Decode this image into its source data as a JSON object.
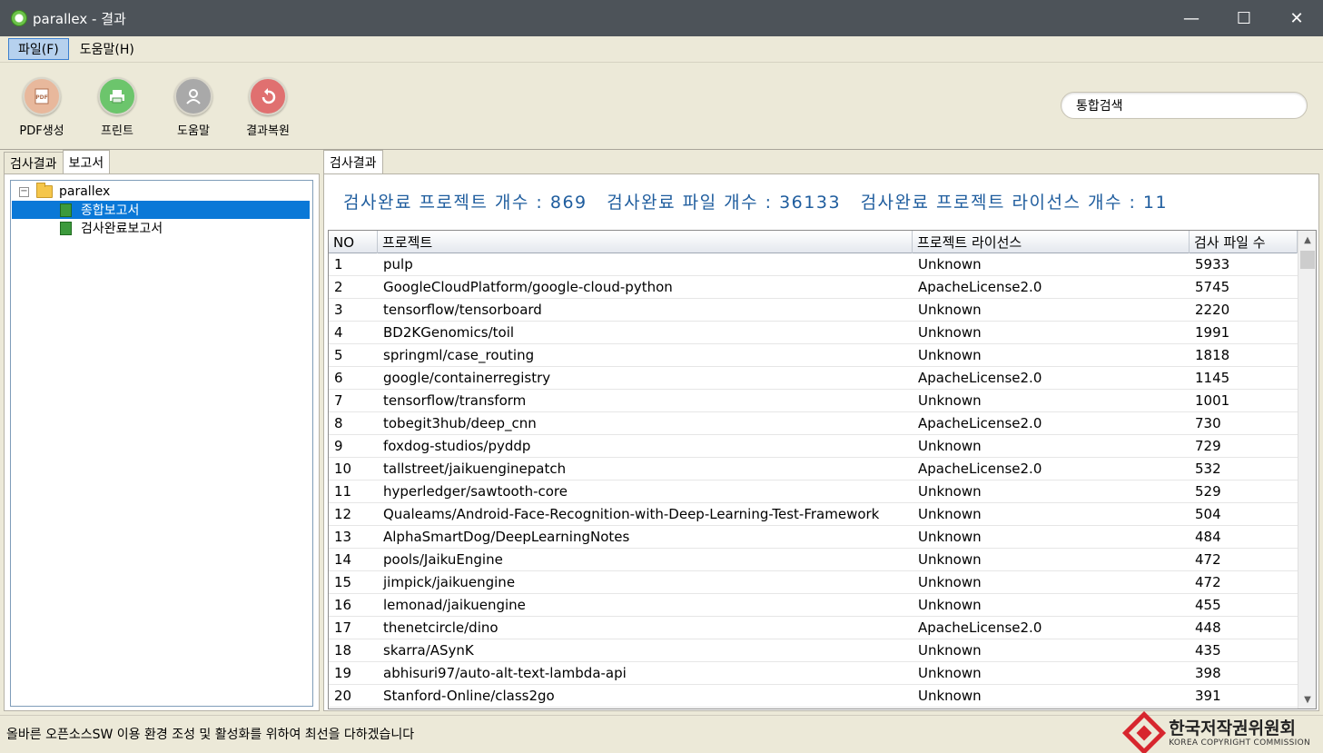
{
  "window": {
    "title": "parallex - 결과",
    "controls": {
      "minimize": "—",
      "maximize": "☐",
      "close": "✕"
    }
  },
  "menu": [
    "파일(F)",
    "도움말(H)"
  ],
  "toolbar": {
    "buttons": [
      {
        "label": "PDF생성",
        "icon": "pdf-icon",
        "color": "#e8b89c"
      },
      {
        "label": "프린트",
        "icon": "printer-icon",
        "color": "#6cc56c"
      },
      {
        "label": "도움말",
        "icon": "help-icon",
        "color": "#a9a9a9"
      },
      {
        "label": "결과복원",
        "icon": "restore-icon",
        "color": "#e07070"
      }
    ],
    "search_value": "통합검색"
  },
  "left": {
    "tabs": [
      "검사결과",
      "보고서"
    ],
    "selected_tab": "보고서",
    "tree": {
      "root": "parallex",
      "root_expander": "⊟",
      "children": [
        "종합보고서",
        "검사완료보고서"
      ],
      "selected": "종합보고서"
    }
  },
  "right": {
    "tab": "검사결과",
    "summary": {
      "projects": "검사완료 프로젝트 개수 : 869",
      "files": "검사완료 파일 개수 : 36133",
      "licenses": "검사완료 프로젝트 라이선스 개수 : 11"
    },
    "table": {
      "columns": [
        "NO",
        "프로젝트",
        "프로젝트 라이선스",
        "검사 파일 수"
      ],
      "rows": [
        [
          "1",
          "pulp",
          "Unknown",
          "5933"
        ],
        [
          "2",
          "GoogleCloudPlatform/google-cloud-python",
          "ApacheLicense2.0",
          "5745"
        ],
        [
          "3",
          "tensorflow/tensorboard",
          "Unknown",
          "2220"
        ],
        [
          "4",
          "BD2KGenomics/toil",
          "Unknown",
          "1991"
        ],
        [
          "5",
          "springml/case_routing",
          "Unknown",
          "1818"
        ],
        [
          "6",
          "google/containerregistry",
          "ApacheLicense2.0",
          "1145"
        ],
        [
          "7",
          "tensorflow/transform",
          "Unknown",
          "1001"
        ],
        [
          "8",
          "tobegit3hub/deep_cnn",
          "ApacheLicense2.0",
          "730"
        ],
        [
          "9",
          "foxdog-studios/pyddp",
          "Unknown",
          "729"
        ],
        [
          "10",
          "tallstreet/jaikuenginepatch",
          "ApacheLicense2.0",
          "532"
        ],
        [
          "11",
          "hyperledger/sawtooth-core",
          "Unknown",
          "529"
        ],
        [
          "12",
          "Qualeams/Android-Face-Recognition-with-Deep-Learning-Test-Framework",
          "Unknown",
          "504"
        ],
        [
          "13",
          "AlphaSmartDog/DeepLearningNotes",
          "Unknown",
          "484"
        ],
        [
          "14",
          "pools/JaikuEngine",
          "Unknown",
          "472"
        ],
        [
          "15",
          "jimpick/jaikuengine",
          "Unknown",
          "472"
        ],
        [
          "16",
          "lemonad/jaikuengine",
          "Unknown",
          "455"
        ],
        [
          "17",
          "thenetcircle/dino",
          "ApacheLicense2.0",
          "448"
        ],
        [
          "18",
          "skarra/ASynK",
          "Unknown",
          "435"
        ],
        [
          "19",
          "abhisuri97/auto-alt-text-lambda-api",
          "Unknown",
          "398"
        ],
        [
          "20",
          "Stanford-Online/class2go",
          "Unknown",
          "391"
        ]
      ]
    },
    "scroll": {
      "up": "▲",
      "down": "▼"
    }
  },
  "status": {
    "text": "올바른 오픈소스SW 이용 환경 조성 및 활성화를 위하여 최선을 다하겠습니다",
    "logo_ko": "한국저작권위원회",
    "logo_en": "KOREA COPYRIGHT COMMISSION"
  }
}
